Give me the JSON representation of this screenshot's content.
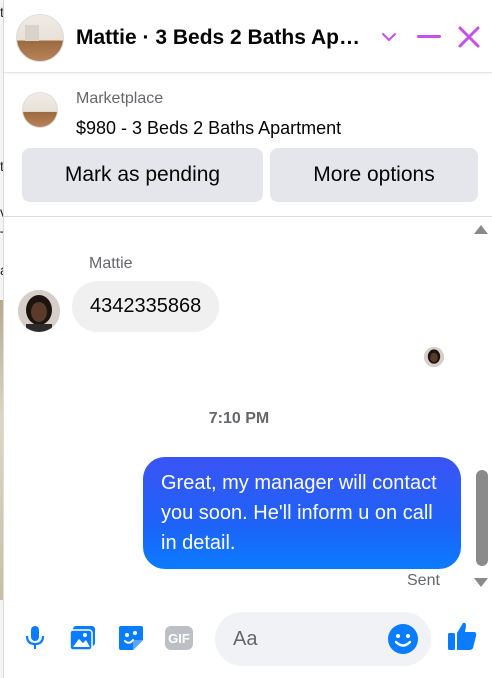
{
  "colors": {
    "accent": "#0a7cff",
    "header_icons": "#c451e8",
    "bubble_in": "#f0f0f0",
    "button_bg": "#e4e6eb"
  },
  "background": {
    "fragments": [
      "t",
      "t",
      "v",
      "T",
      "a"
    ]
  },
  "header": {
    "title": "Mattie · 3 Beds 2 Baths Ap…",
    "avatar_icon": "listing-photo",
    "controls": {
      "chevron": "chevron-down-icon",
      "minimize": "minimize-icon",
      "close": "close-icon"
    }
  },
  "marketplace": {
    "label": "Marketplace",
    "item": "$980 - 3 Beds 2 Baths Apartment"
  },
  "actions": {
    "pending": "Mark as pending",
    "more": "More options"
  },
  "conversation": {
    "sender_name": "Mattie",
    "incoming_message": "4342335868",
    "timestamp": "7:10 PM",
    "outgoing_message": "Great, my manager will contact you soon. He'll inform u on call in detail.",
    "status": "Sent"
  },
  "composer": {
    "placeholder": "Aa",
    "icons": [
      "microphone-icon",
      "photo-icon",
      "sticker-icon",
      "gif-icon",
      "emoji-icon",
      "like-icon"
    ],
    "gif_label": "GIF"
  }
}
